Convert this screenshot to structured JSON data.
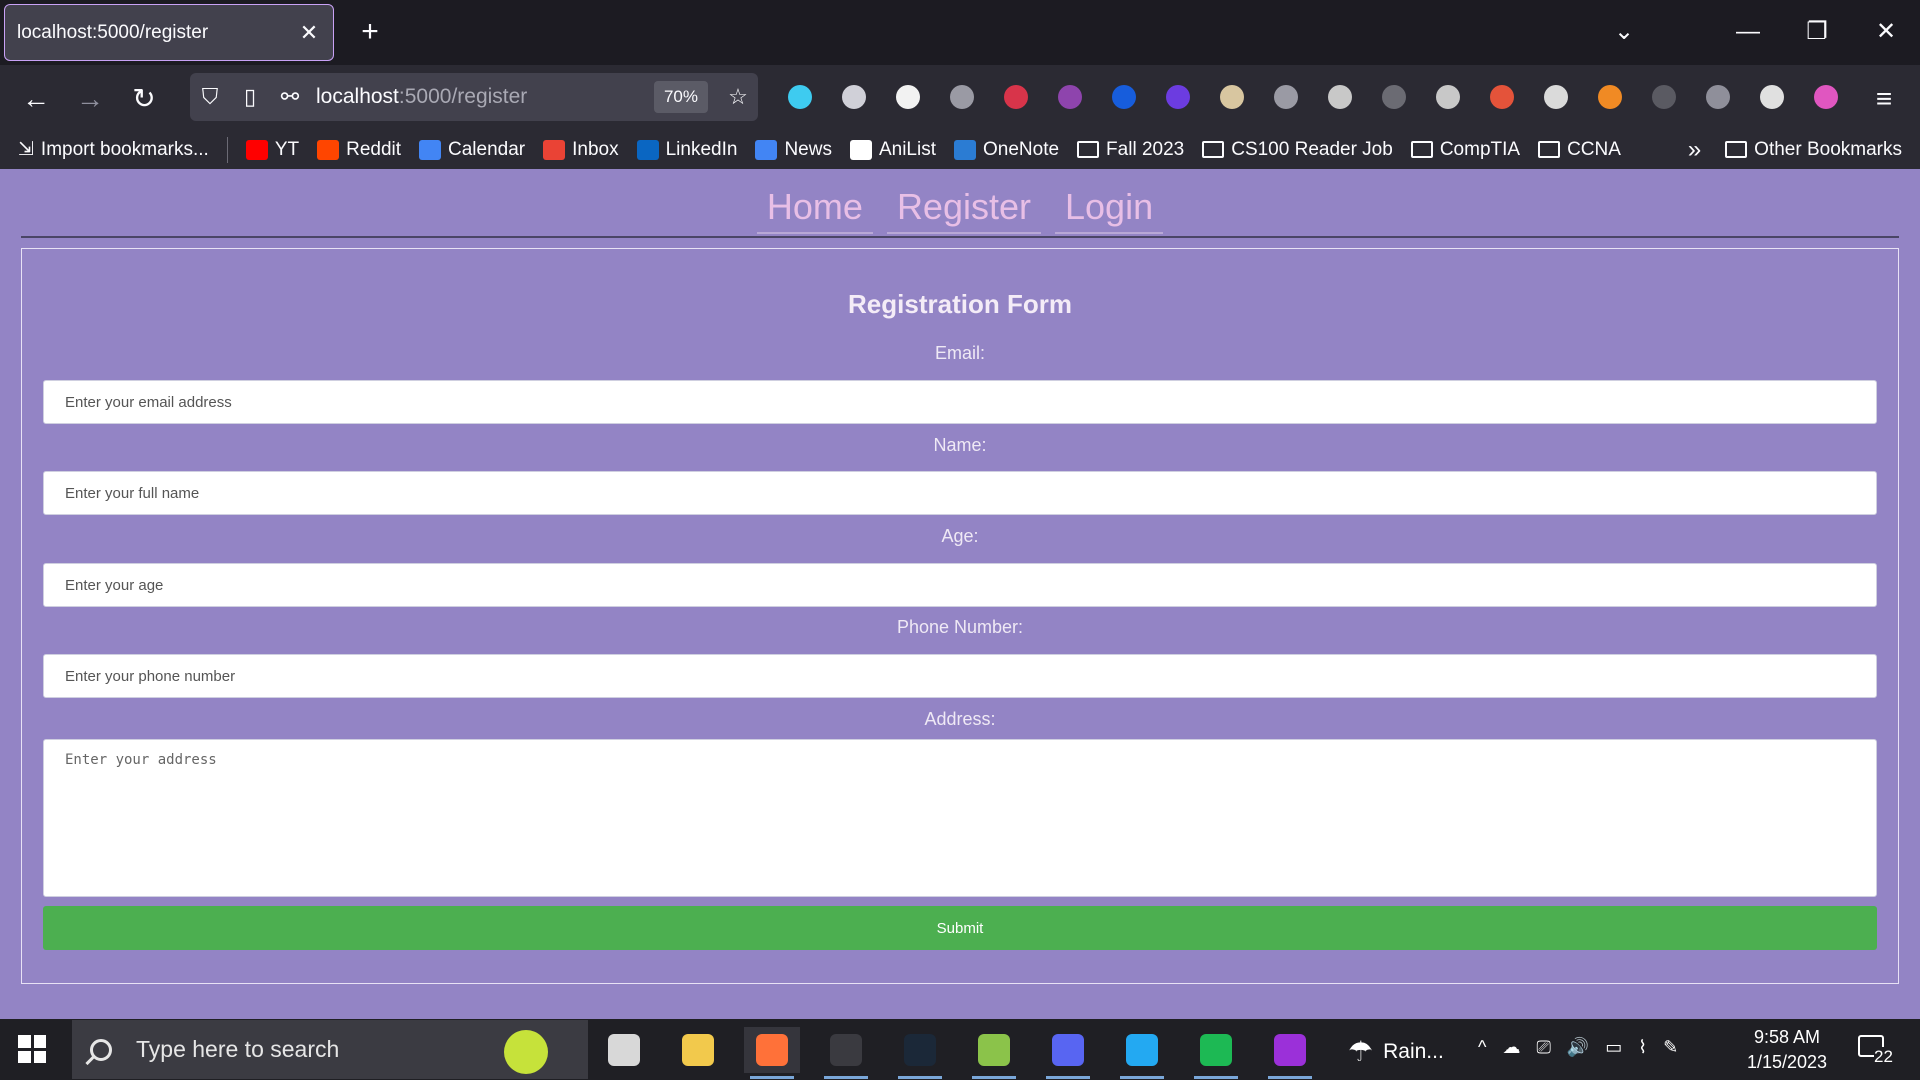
{
  "browser": {
    "tab_title": "localhost:5000/register",
    "tab_close": "✕",
    "new_tab": "+",
    "url_host": "localhost",
    "url_path": ":5000/register",
    "zoom": "70%",
    "window_controls": [
      "⌄",
      "—",
      "❐",
      "✕"
    ],
    "nav": {
      "back": "←",
      "forward": "→",
      "reload": "↻",
      "menu": "≡"
    },
    "extensions": [
      {
        "name": "downloads-icon",
        "color": "#3ecbf0"
      },
      {
        "name": "history-icon",
        "color": "#d0d0d8"
      },
      {
        "name": "extension-m-icon",
        "color": "#f2f2f2"
      },
      {
        "name": "extension-puzzle-icon",
        "color": "#9a9aa4"
      },
      {
        "name": "extension-red-circle-icon",
        "color": "#d8344a"
      },
      {
        "name": "extension-purple-circle-icon",
        "color": "#8e44ad"
      },
      {
        "name": "bitwarden-icon",
        "color": "#175ddc"
      },
      {
        "name": "extension-stack-icon",
        "color": "#6c3ce0"
      },
      {
        "name": "extension-owl-icon",
        "color": "#d8c6a0"
      },
      {
        "name": "ublock-icon",
        "color": "#9a9aa4"
      },
      {
        "name": "cookie-icon",
        "color": "#c8c8c8"
      },
      {
        "name": "speaker-icon",
        "color": "#6b6b73"
      },
      {
        "name": "extension-glasses-icon",
        "color": "#c8c8c8"
      },
      {
        "name": "extension-fox-red-icon",
        "color": "#e4533a"
      },
      {
        "name": "react-devtools-icon",
        "color": "#dadada"
      },
      {
        "name": "metamask-icon",
        "color": "#f08a24"
      },
      {
        "name": "pdf-icon",
        "color": "#5a5a62"
      },
      {
        "name": "extension-k-icon",
        "color": "#8f8f9a"
      },
      {
        "name": "extension-paw-icon",
        "color": "#e0e0e0"
      },
      {
        "name": "profile-avatar-icon",
        "color": "#e056c0"
      }
    ]
  },
  "bookmarks": {
    "import": "Import bookmarks...",
    "items": [
      {
        "label": "YT",
        "color": "#ff0000",
        "kind": "site"
      },
      {
        "label": "Reddit",
        "color": "#ff4500",
        "kind": "site"
      },
      {
        "label": "Calendar",
        "color": "#4285f4",
        "kind": "site"
      },
      {
        "label": "Inbox",
        "color": "#ea4335",
        "kind": "site"
      },
      {
        "label": "LinkedIn",
        "color": "#0a66c2",
        "kind": "site"
      },
      {
        "label": "News",
        "color": "#4285f4",
        "kind": "site"
      },
      {
        "label": "AniList",
        "color": "#ffffff",
        "kind": "site"
      },
      {
        "label": "OneNote",
        "color": "#2b7cd3",
        "kind": "site"
      },
      {
        "label": "Fall 2023",
        "kind": "folder"
      },
      {
        "label": "CS100 Reader Job",
        "kind": "folder"
      },
      {
        "label": "CompTIA",
        "kind": "folder"
      },
      {
        "label": "CCNA",
        "kind": "folder"
      }
    ],
    "overflow": "»",
    "other": "Other Bookmarks"
  },
  "site_nav": {
    "home": "Home",
    "register": "Register",
    "login": "Login"
  },
  "form": {
    "title": "Registration Form",
    "email_label": "Email:",
    "email_placeholder": "Enter your email address",
    "name_label": "Name:",
    "name_placeholder": "Enter your full name",
    "age_label": "Age:",
    "age_placeholder": "Enter your age",
    "phone_label": "Phone Number:",
    "phone_placeholder": "Enter your phone number",
    "address_label": "Address:",
    "address_placeholder": "Enter your address",
    "submit": "Submit",
    "submit_color": "#4caf50"
  },
  "taskbar": {
    "search_placeholder": "Type here to search",
    "apps": [
      {
        "name": "task-view-icon",
        "color": "#d8d8d8",
        "active": false,
        "running": false
      },
      {
        "name": "file-explorer-icon",
        "color": "#f2c94c",
        "active": false,
        "running": false
      },
      {
        "name": "firefox-icon",
        "color": "#ff7139",
        "active": true,
        "running": true
      },
      {
        "name": "terminal-icon",
        "color": "#3a3a40",
        "active": false,
        "running": true
      },
      {
        "name": "steam-icon",
        "color": "#1b2838",
        "active": false,
        "running": true
      },
      {
        "name": "notepad-plus-icon",
        "color": "#8bc34a",
        "active": false,
        "running": true
      },
      {
        "name": "discord-icon",
        "color": "#5865f2",
        "active": false,
        "running": true
      },
      {
        "name": "vscode-icon",
        "color": "#23a9f2",
        "active": false,
        "running": true
      },
      {
        "name": "spotify-icon",
        "color": "#1db954",
        "active": false,
        "running": true
      },
      {
        "name": "mask-app-icon",
        "color": "#9b30d9",
        "active": false,
        "running": true
      }
    ],
    "weather": "Rain...",
    "tray": [
      "^",
      "☁",
      "⎚",
      "🔊",
      "▭",
      "⌇",
      "✎"
    ],
    "time": "9:58 AM",
    "date": "1/15/2023",
    "notifications": "22"
  }
}
